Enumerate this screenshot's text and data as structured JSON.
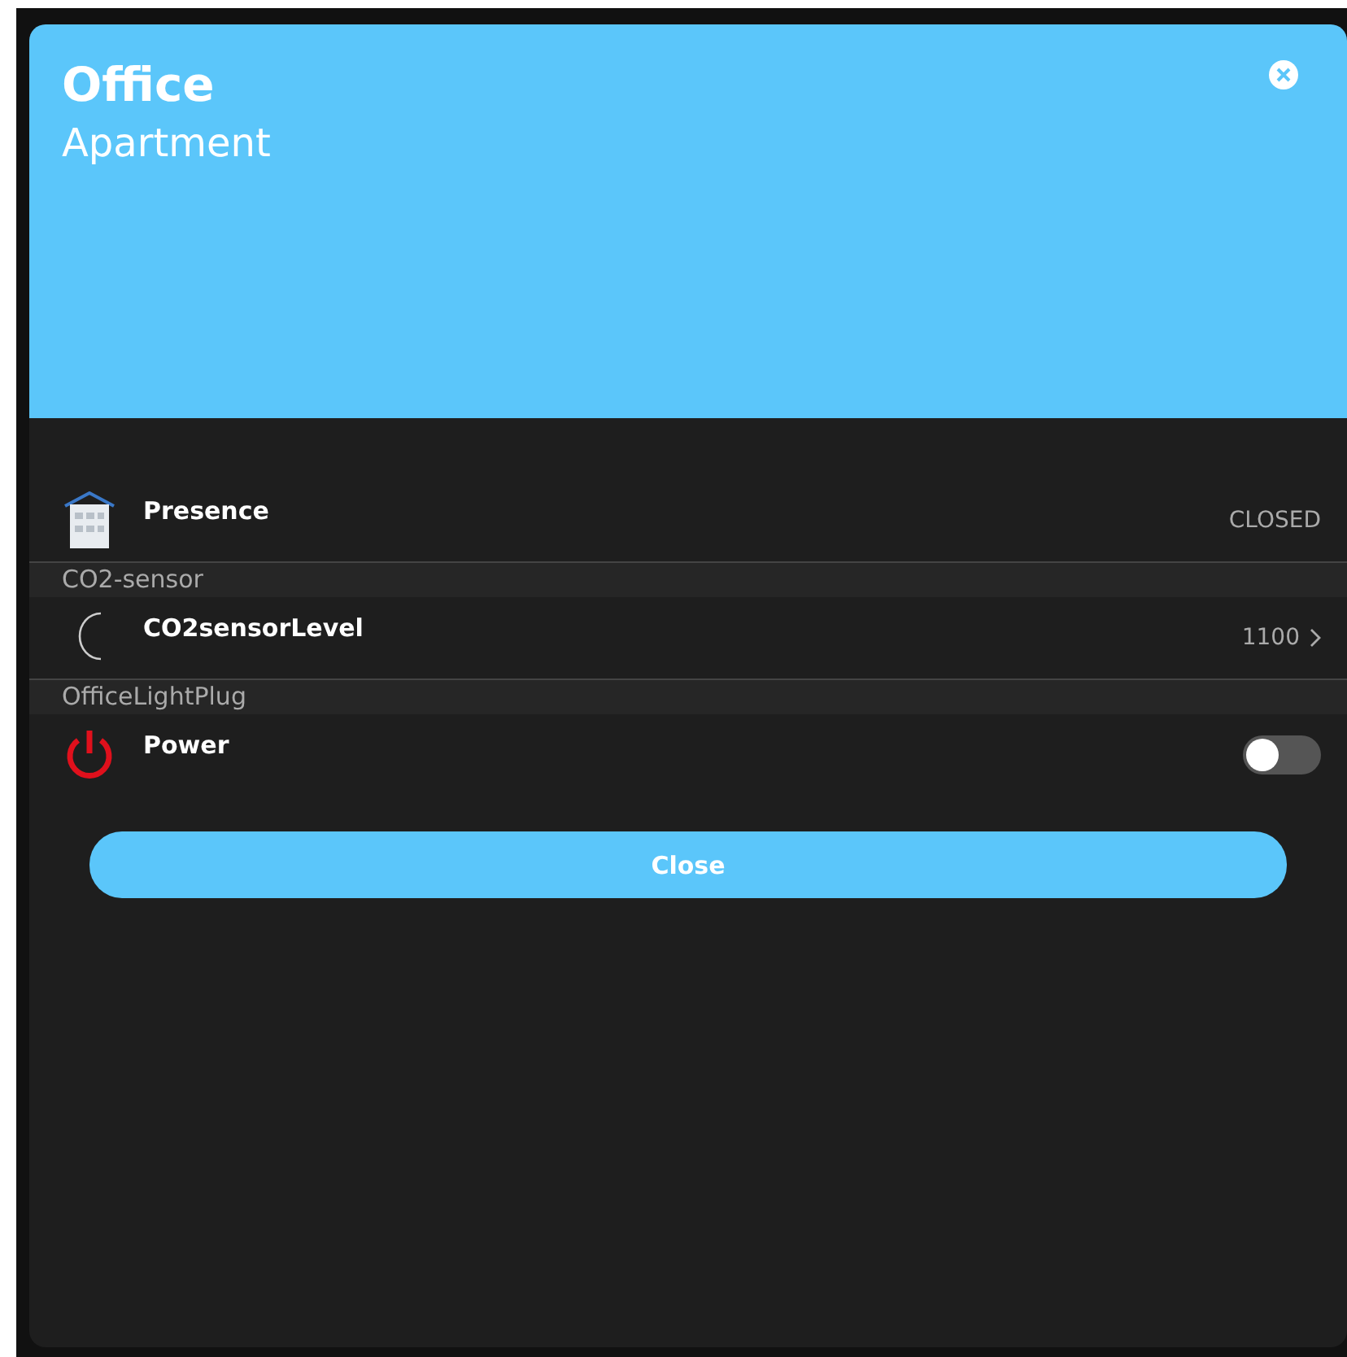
{
  "header": {
    "title": "Office",
    "subtitle": "Apartment"
  },
  "rows": [
    {
      "kind": "state",
      "label": "Presence",
      "value": "CLOSED"
    },
    {
      "kind": "group",
      "label": "CO2-sensor"
    },
    {
      "kind": "value",
      "label": "CO2sensorLevel",
      "value": "1100"
    },
    {
      "kind": "group",
      "label": "OfficeLightPlug"
    },
    {
      "kind": "switch",
      "label": "Power",
      "on": false
    }
  ],
  "button": "Close"
}
